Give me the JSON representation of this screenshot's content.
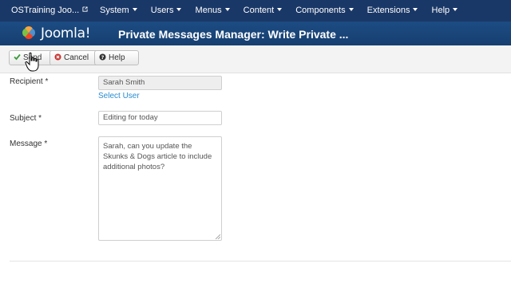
{
  "topnav": {
    "site_name": "OSTraining Joo...",
    "menu": [
      "System",
      "Users",
      "Menus",
      "Content",
      "Components",
      "Extensions",
      "Help"
    ]
  },
  "header": {
    "logo_text": "Joomla!",
    "title": "Private Messages Manager: Write Private ..."
  },
  "toolbar": {
    "send_label": "Send",
    "cancel_label": "Cancel",
    "help_label": "Help"
  },
  "form": {
    "recipient_label": "Recipient *",
    "recipient_value": "Sarah Smith",
    "select_user_label": "Select User",
    "subject_label": "Subject *",
    "subject_value": "Editing for today",
    "message_label": "Message *",
    "message_value": "Sarah, can you update the Skunks & Dogs article to include additional photos?"
  },
  "colors": {
    "topnav_bg": "#1a3867",
    "header_bg": "#1c4c83",
    "link": "#2a8bd0",
    "send_check": "#3b9a3b",
    "cancel_x": "#c9302c"
  }
}
